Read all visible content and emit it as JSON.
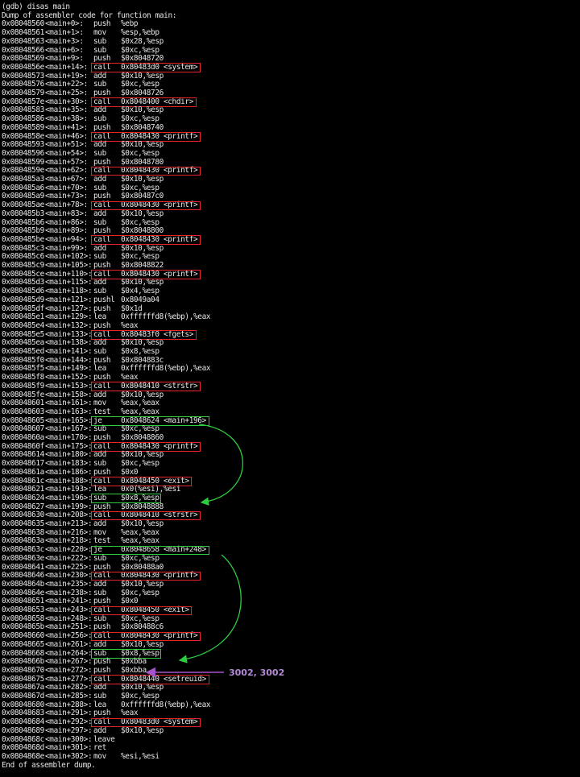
{
  "terminal": {
    "prompt_line": "(gdb) disas main",
    "dump_header": "Dump of assembler code for function main:",
    "dump_footer": "End of assembler dump.",
    "annotation": "3002, 3002",
    "colors": {
      "background": "#000000",
      "text": "#e8e8e8",
      "call_box": "#e8242b",
      "jump_box": "#2ecc40",
      "arrow_green": "#2ecc40",
      "arrow_purple": "#a455c8"
    },
    "instructions": [
      {
        "addr": "0x08048560",
        "off": "<main+0>:",
        "mn": "push",
        "op": "%ebp"
      },
      {
        "addr": "0x08048561",
        "off": "<main+1>:",
        "mn": "mov",
        "op": "%esp,%ebp"
      },
      {
        "addr": "0x08048563",
        "off": "<main+3>:",
        "mn": "sub",
        "op": "$0x28,%esp"
      },
      {
        "addr": "0x08048566",
        "off": "<main+6>:",
        "mn": "sub",
        "op": "$0xc,%esp"
      },
      {
        "addr": "0x08048569",
        "off": "<main+9>:",
        "mn": "push",
        "op": "$0x8048720"
      },
      {
        "addr": "0x0804856e",
        "off": "<main+14>:",
        "mn": "call",
        "op": "0x80483d0 <system>",
        "hl": "red"
      },
      {
        "addr": "0x08048573",
        "off": "<main+19>:",
        "mn": "add",
        "op": "$0x10,%esp"
      },
      {
        "addr": "0x08048576",
        "off": "<main+22>:",
        "mn": "sub",
        "op": "$0xc,%esp"
      },
      {
        "addr": "0x08048579",
        "off": "<main+25>:",
        "mn": "push",
        "op": "$0x8048726"
      },
      {
        "addr": "0x0804857e",
        "off": "<main+30>:",
        "mn": "call",
        "op": "0x8048400 <chdir>",
        "hl": "red"
      },
      {
        "addr": "0x08048583",
        "off": "<main+35>:",
        "mn": "add",
        "op": "$0x10,%esp"
      },
      {
        "addr": "0x08048586",
        "off": "<main+38>:",
        "mn": "sub",
        "op": "$0xc,%esp"
      },
      {
        "addr": "0x08048589",
        "off": "<main+41>:",
        "mn": "push",
        "op": "$0x8048740"
      },
      {
        "addr": "0x0804858e",
        "off": "<main+46>:",
        "mn": "call",
        "op": "0x8048430 <printf>",
        "hl": "red"
      },
      {
        "addr": "0x08048593",
        "off": "<main+51>:",
        "mn": "add",
        "op": "$0x10,%esp"
      },
      {
        "addr": "0x08048596",
        "off": "<main+54>:",
        "mn": "sub",
        "op": "$0xc,%esp"
      },
      {
        "addr": "0x08048599",
        "off": "<main+57>:",
        "mn": "push",
        "op": "$0x8048780"
      },
      {
        "addr": "0x0804859e",
        "off": "<main+62>:",
        "mn": "call",
        "op": "0x8048430 <printf>",
        "hl": "red"
      },
      {
        "addr": "0x080485a3",
        "off": "<main+67>:",
        "mn": "add",
        "op": "$0x10,%esp"
      },
      {
        "addr": "0x080485a6",
        "off": "<main+70>:",
        "mn": "sub",
        "op": "$0xc,%esp"
      },
      {
        "addr": "0x080485a9",
        "off": "<main+73>:",
        "mn": "push",
        "op": "$0x80487c0"
      },
      {
        "addr": "0x080485ae",
        "off": "<main+78>:",
        "mn": "call",
        "op": "0x8048430 <printf>",
        "hl": "red"
      },
      {
        "addr": "0x080485b3",
        "off": "<main+83>:",
        "mn": "add",
        "op": "$0x10,%esp"
      },
      {
        "addr": "0x080485b6",
        "off": "<main+86>:",
        "mn": "sub",
        "op": "$0xc,%esp"
      },
      {
        "addr": "0x080485b9",
        "off": "<main+89>:",
        "mn": "push",
        "op": "$0x8048800"
      },
      {
        "addr": "0x080485be",
        "off": "<main+94>:",
        "mn": "call",
        "op": "0x8048430 <printf>",
        "hl": "red"
      },
      {
        "addr": "0x080485c3",
        "off": "<main+99>:",
        "mn": "add",
        "op": "$0x10,%esp"
      },
      {
        "addr": "0x080485c6",
        "off": "<main+102>:",
        "mn": "sub",
        "op": "$0xc,%esp"
      },
      {
        "addr": "0x080485c9",
        "off": "<main+105>:",
        "mn": "push",
        "op": "$0x8048822"
      },
      {
        "addr": "0x080485ce",
        "off": "<main+110>:",
        "mn": "call",
        "op": "0x8048430 <printf>",
        "hl": "red"
      },
      {
        "addr": "0x080485d3",
        "off": "<main+115>:",
        "mn": "add",
        "op": "$0x10,%esp"
      },
      {
        "addr": "0x080485d6",
        "off": "<main+118>:",
        "mn": "sub",
        "op": "$0x4,%esp"
      },
      {
        "addr": "0x080485d9",
        "off": "<main+121>:",
        "mn": "pushl",
        "op": "0x8049a04"
      },
      {
        "addr": "0x080485df",
        "off": "<main+127>:",
        "mn": "push",
        "op": "$0x1d"
      },
      {
        "addr": "0x080485e1",
        "off": "<main+129>:",
        "mn": "lea",
        "op": "0xffffffd8(%ebp),%eax"
      },
      {
        "addr": "0x080485e4",
        "off": "<main+132>:",
        "mn": "push",
        "op": "%eax"
      },
      {
        "addr": "0x080485e5",
        "off": "<main+133>:",
        "mn": "call",
        "op": "0x80483f0 <fgets>",
        "hl": "red"
      },
      {
        "addr": "0x080485ea",
        "off": "<main+138>:",
        "mn": "add",
        "op": "$0x10,%esp"
      },
      {
        "addr": "0x080485ed",
        "off": "<main+141>:",
        "mn": "sub",
        "op": "$0x8,%esp"
      },
      {
        "addr": "0x080485f0",
        "off": "<main+144>:",
        "mn": "push",
        "op": "$0x804883c"
      },
      {
        "addr": "0x080485f5",
        "off": "<main+149>:",
        "mn": "lea",
        "op": "0xffffffd8(%ebp),%eax"
      },
      {
        "addr": "0x080485f8",
        "off": "<main+152>:",
        "mn": "push",
        "op": "%eax"
      },
      {
        "addr": "0x080485f9",
        "off": "<main+153>:",
        "mn": "call",
        "op": "0x8048410 <strstr>",
        "hl": "red"
      },
      {
        "addr": "0x080485fe",
        "off": "<main+158>:",
        "mn": "add",
        "op": "$0x10,%esp"
      },
      {
        "addr": "0x08048601",
        "off": "<main+161>:",
        "mn": "mov",
        "op": "%eax,%eax"
      },
      {
        "addr": "0x08048603",
        "off": "<main+163>:",
        "mn": "test",
        "op": "%eax,%eax"
      },
      {
        "addr": "0x08048605",
        "off": "<main+165>:",
        "mn": "je",
        "op": "0x8048624 <main+196>",
        "hl": "green"
      },
      {
        "addr": "0x08048607",
        "off": "<main+167>:",
        "mn": "sub",
        "op": "$0xc,%esp"
      },
      {
        "addr": "0x0804860a",
        "off": "<main+170>:",
        "mn": "push",
        "op": "$0x8048860"
      },
      {
        "addr": "0x0804860f",
        "off": "<main+175>:",
        "mn": "call",
        "op": "0x8048430 <printf>",
        "hl": "red"
      },
      {
        "addr": "0x08048614",
        "off": "<main+180>:",
        "mn": "add",
        "op": "$0x10,%esp"
      },
      {
        "addr": "0x08048617",
        "off": "<main+183>:",
        "mn": "sub",
        "op": "$0xc,%esp"
      },
      {
        "addr": "0x0804861a",
        "off": "<main+186>:",
        "mn": "push",
        "op": "$0x0"
      },
      {
        "addr": "0x0804861c",
        "off": "<main+188>:",
        "mn": "call",
        "op": "0x8048450 <exit>",
        "hl": "red"
      },
      {
        "addr": "0x08048621",
        "off": "<main+193>:",
        "mn": "lea",
        "op": "0x0(%esi),%esi"
      },
      {
        "addr": "0x08048624",
        "off": "<main+196>:",
        "mn": "sub",
        "op": "$0x8,%esp",
        "hl": "green"
      },
      {
        "addr": "0x08048627",
        "off": "<main+199>:",
        "mn": "push",
        "op": "$0x8048888"
      },
      {
        "addr": "0x08048630",
        "off": "<main+208>:",
        "mn": "call",
        "op": "0x8048410 <strstr>",
        "hl": "red"
      },
      {
        "addr": "0x08048635",
        "off": "<main+213>:",
        "mn": "add",
        "op": "$0x10,%esp"
      },
      {
        "addr": "0x08048638",
        "off": "<main+216>:",
        "mn": "mov",
        "op": "%eax,%eax"
      },
      {
        "addr": "0x0804863a",
        "off": "<main+218>:",
        "mn": "test",
        "op": "%eax,%eax"
      },
      {
        "addr": "0x0804863c",
        "off": "<main+220>:",
        "mn": "je",
        "op": "0x8048658 <main+248>",
        "hl": "green"
      },
      {
        "addr": "0x0804863e",
        "off": "<main+222>:",
        "mn": "sub",
        "op": "$0xc,%esp"
      },
      {
        "addr": "0x08048641",
        "off": "<main+225>:",
        "mn": "push",
        "op": "$0x80488a0"
      },
      {
        "addr": "0x08048646",
        "off": "<main+230>:",
        "mn": "call",
        "op": "0x8048430 <printf>",
        "hl": "red"
      },
      {
        "addr": "0x0804864b",
        "off": "<main+235>:",
        "mn": "add",
        "op": "$0x10,%esp"
      },
      {
        "addr": "0x0804864e",
        "off": "<main+238>:",
        "mn": "sub",
        "op": "$0xc,%esp"
      },
      {
        "addr": "0x08048651",
        "off": "<main+241>:",
        "mn": "push",
        "op": "$0x0"
      },
      {
        "addr": "0x08048653",
        "off": "<main+243>:",
        "mn": "call",
        "op": "0x8048450 <exit>",
        "hl": "red"
      },
      {
        "addr": "0x08048658",
        "off": "<main+248>:",
        "mn": "sub",
        "op": "$0xc,%esp"
      },
      {
        "addr": "0x0804865b",
        "off": "<main+251>:",
        "mn": "push",
        "op": "$0x80488c6"
      },
      {
        "addr": "0x08048660",
        "off": "<main+256>:",
        "mn": "call",
        "op": "0x8048430 <printf>",
        "hl": "red"
      },
      {
        "addr": "0x08048665",
        "off": "<main+261>:",
        "mn": "add",
        "op": "$0x10,%esp"
      },
      {
        "addr": "0x08048668",
        "off": "<main+264>:",
        "mn": "sub",
        "op": "$0x8,%esp",
        "hl": "green"
      },
      {
        "addr": "0x0804866b",
        "off": "<main+267>:",
        "mn": "push",
        "op": "$0xbba"
      },
      {
        "addr": "0x08048670",
        "off": "<main+272>:",
        "mn": "push",
        "op": "$0xbba"
      },
      {
        "addr": "0x08048675",
        "off": "<main+277>:",
        "mn": "call",
        "op": "0x8048440 <setreuid>",
        "hl": "red"
      },
      {
        "addr": "0x0804867a",
        "off": "<main+282>:",
        "mn": "add",
        "op": "$0x10,%esp"
      },
      {
        "addr": "0x0804867d",
        "off": "<main+285>:",
        "mn": "sub",
        "op": "$0xc,%esp"
      },
      {
        "addr": "0x08048680",
        "off": "<main+288>:",
        "mn": "lea",
        "op": "0xffffffd8(%ebp),%eax"
      },
      {
        "addr": "0x08048683",
        "off": "<main+291>:",
        "mn": "push",
        "op": "%eax"
      },
      {
        "addr": "0x08048684",
        "off": "<main+292>:",
        "mn": "call",
        "op": "0x80483d0 <system>",
        "hl": "red"
      },
      {
        "addr": "0x08048689",
        "off": "<main+297>:",
        "mn": "add",
        "op": "$0x10,%esp"
      },
      {
        "addr": "0x0804868c",
        "off": "<main+300>:",
        "mn": "leave",
        "op": ""
      },
      {
        "addr": "0x0804868d",
        "off": "<main+301>:",
        "mn": "ret",
        "op": ""
      },
      {
        "addr": "0x0804868e",
        "off": "<main+302>:",
        "mn": "mov",
        "op": "%esi,%esi"
      }
    ]
  }
}
